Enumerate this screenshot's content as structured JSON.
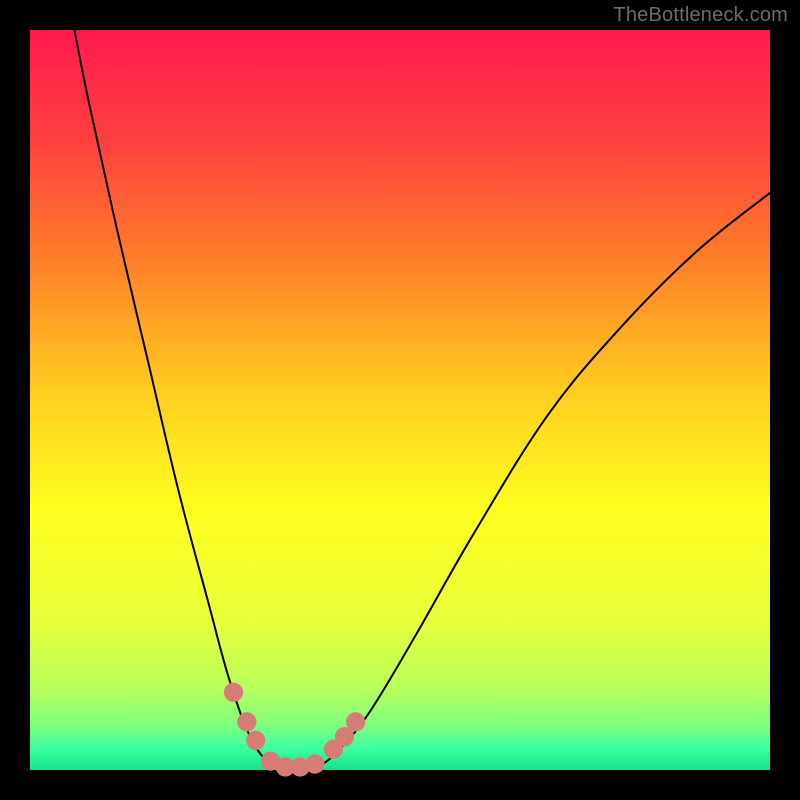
{
  "watermark": "TheBottleneck.com",
  "chart_data": {
    "type": "line",
    "title": "",
    "xlabel": "",
    "ylabel": "",
    "xlim": [
      0,
      100
    ],
    "ylim": [
      0,
      100
    ],
    "legend": [],
    "annotations": [],
    "gradient_stops": [
      {
        "offset": 0.0,
        "color": "#ff1a4d"
      },
      {
        "offset": 0.15,
        "color": "#ff4040"
      },
      {
        "offset": 0.3,
        "color": "#ff7a2a"
      },
      {
        "offset": 0.5,
        "color": "#ffd21f"
      },
      {
        "offset": 0.65,
        "color": "#ffff1f"
      },
      {
        "offset": 0.8,
        "color": "#e8ff3a"
      },
      {
        "offset": 0.89,
        "color": "#b8ff5c"
      },
      {
        "offset": 0.94,
        "color": "#7dff7d"
      },
      {
        "offset": 0.97,
        "color": "#3fffa0"
      },
      {
        "offset": 1.0,
        "color": "#17e18d"
      }
    ],
    "series": [
      {
        "name": "bottleneck-curve",
        "color": "#000000",
        "points": [
          {
            "x": 6.0,
            "y": 100.0
          },
          {
            "x": 8.0,
            "y": 90.0
          },
          {
            "x": 12.0,
            "y": 72.0
          },
          {
            "x": 16.0,
            "y": 55.0
          },
          {
            "x": 20.0,
            "y": 38.0
          },
          {
            "x": 24.0,
            "y": 23.0
          },
          {
            "x": 27.0,
            "y": 12.0
          },
          {
            "x": 30.0,
            "y": 4.0
          },
          {
            "x": 33.0,
            "y": 0.5
          },
          {
            "x": 36.0,
            "y": 0.0
          },
          {
            "x": 39.0,
            "y": 0.5
          },
          {
            "x": 42.0,
            "y": 3.0
          },
          {
            "x": 46.0,
            "y": 8.0
          },
          {
            "x": 52.0,
            "y": 18.0
          },
          {
            "x": 60.0,
            "y": 32.0
          },
          {
            "x": 70.0,
            "y": 48.0
          },
          {
            "x": 80.0,
            "y": 60.0
          },
          {
            "x": 90.0,
            "y": 70.0
          },
          {
            "x": 100.0,
            "y": 78.0
          }
        ]
      }
    ],
    "markers": {
      "color": "#d77b75",
      "radius_pct": 1.3,
      "points": [
        {
          "x": 27.5,
          "y": 10.5
        },
        {
          "x": 29.3,
          "y": 6.5
        },
        {
          "x": 30.5,
          "y": 4.0
        },
        {
          "x": 32.5,
          "y": 1.2
        },
        {
          "x": 34.5,
          "y": 0.4
        },
        {
          "x": 36.5,
          "y": 0.4
        },
        {
          "x": 38.5,
          "y": 0.8
        },
        {
          "x": 41.0,
          "y": 2.8
        },
        {
          "x": 42.5,
          "y": 4.5
        },
        {
          "x": 44.0,
          "y": 6.5
        }
      ]
    }
  }
}
